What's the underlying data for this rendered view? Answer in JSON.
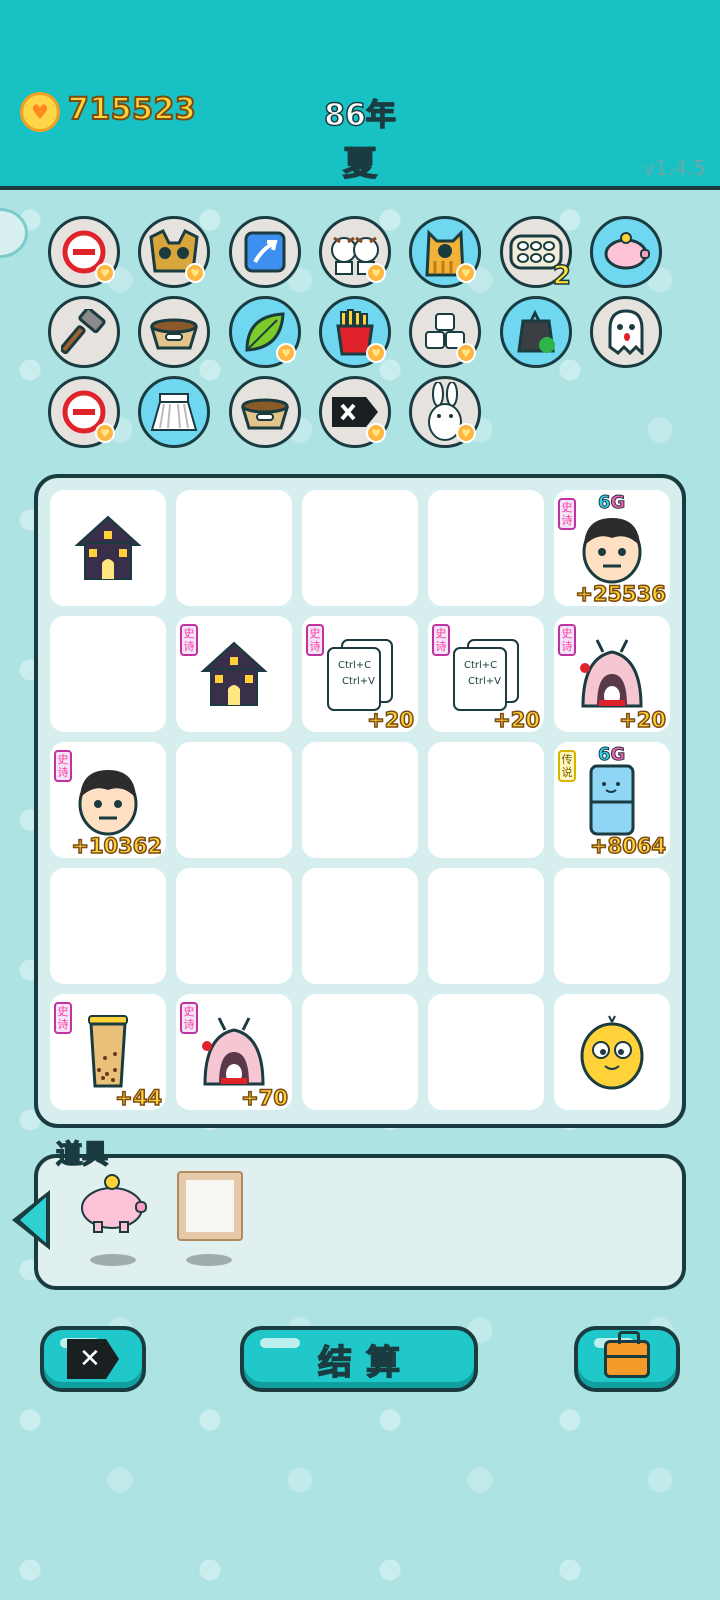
{
  "header": {
    "coins": "715523",
    "year": "86年",
    "season": "夏",
    "version": "v1.4.5"
  },
  "items_row1": [
    {
      "icon": "minus-circle-icon",
      "fav": true
    },
    {
      "icon": "cat-in-box-icon",
      "fav": true
    },
    {
      "icon": "up-arrow-card-icon",
      "fav": false
    },
    {
      "icon": "cow-couple-icon",
      "fav": true
    },
    {
      "icon": "cat-icon",
      "fav": true
    },
    {
      "icon": "egg-tray-icon",
      "fav": false,
      "count": "2"
    },
    {
      "icon": "piggy-bank-icon",
      "fav": false
    }
  ],
  "items_row2": [
    {
      "icon": "hammer-icon",
      "fav": false
    },
    {
      "icon": "pet-bowl-icon",
      "fav": false
    },
    {
      "icon": "leaf-icon",
      "fav": true
    },
    {
      "icon": "french-fries-icon",
      "fav": true
    },
    {
      "icon": "sugar-cubes-icon",
      "fav": true
    },
    {
      "icon": "recycle-bag-icon",
      "fav": false
    },
    {
      "icon": "ghost-icon",
      "fav": false
    }
  ],
  "items_row3": [
    {
      "icon": "minus-circle-icon",
      "fav": true
    },
    {
      "icon": "skirt-icon",
      "fav": false
    },
    {
      "icon": "pet-bowl-icon",
      "fav": false
    },
    {
      "icon": "delete-tag-icon",
      "fav": true
    },
    {
      "icon": "rabbit-icon",
      "fav": true
    }
  ],
  "grid": {
    "cells": [
      {
        "row": 0,
        "col": 0,
        "icon": "haunted-house-icon"
      },
      {
        "row": 0,
        "col": 4,
        "icon": "man-face-icon",
        "tag": "史诗",
        "gen": "6G",
        "bonus": "+25536"
      },
      {
        "row": 1,
        "col": 1,
        "icon": "haunted-house-icon",
        "tag": "史诗"
      },
      {
        "row": 1,
        "col": 2,
        "icon": "copy-paste-icon",
        "tag": "史诗",
        "bonus": "+20",
        "text1": "Ctrl+C",
        "text2": "Ctrl+V"
      },
      {
        "row": 1,
        "col": 3,
        "icon": "copy-paste-icon",
        "tag": "史诗",
        "bonus": "+20",
        "text1": "Ctrl+C",
        "text2": "Ctrl+V"
      },
      {
        "row": 1,
        "col": 4,
        "icon": "rabbit-house-icon",
        "tag": "史诗",
        "bonus": "+20"
      },
      {
        "row": 2,
        "col": 0,
        "icon": "man-face-icon",
        "tag": "史诗",
        "bonus": "+10362"
      },
      {
        "row": 2,
        "col": 4,
        "icon": "fridge-icon",
        "tag": "传说",
        "gen": "6G",
        "bonus": "+8064"
      },
      {
        "row": 4,
        "col": 0,
        "icon": "bubble-tea-icon",
        "tag": "史诗",
        "bonus": "+44"
      },
      {
        "row": 4,
        "col": 1,
        "icon": "rabbit-house-icon",
        "tag": "史诗",
        "bonus": "+70"
      },
      {
        "row": 4,
        "col": 4,
        "icon": "yellow-chick-icon"
      }
    ]
  },
  "props": {
    "title": "道具",
    "items": [
      {
        "icon": "piggy-bank-icon"
      },
      {
        "icon": "picture-frame-icon"
      }
    ]
  },
  "buttons": {
    "delete_icon": "delete-tag-icon",
    "settle_label": "结算",
    "bag_icon": "briefcase-icon"
  },
  "colors": {
    "header": "#18c2c4",
    "background": "#b9e9ea",
    "outline": "#1a3b3f",
    "coin_text": "#ffd23a",
    "epic_tag": "#ff3aa6",
    "legend_tag": "#d6b400"
  }
}
